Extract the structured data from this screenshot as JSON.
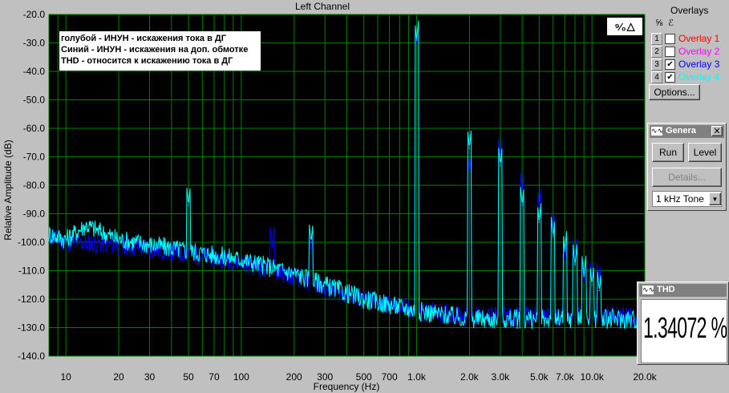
{
  "window": {
    "title": "Left Channel"
  },
  "toolbar": {
    "icons": [
      "scale-icon",
      "cursor-icon"
    ]
  },
  "legend": {
    "lines": [
      "голубой - ИНУН - искажения тока в ДГ",
      "Синий - ИНУН - искажения на доп. обмотке",
      "THD - относится к искажению тока в ДГ"
    ]
  },
  "overlays": {
    "title": "Overlays",
    "header_icons": "⅝ ℰ",
    "items": [
      {
        "num": "1",
        "label": "Overlay 1",
        "checked": false,
        "color": "#ff0000"
      },
      {
        "num": "2",
        "label": "Overlay 2",
        "checked": false,
        "color": "#ff00ff"
      },
      {
        "num": "3",
        "label": "Overlay 3",
        "checked": true,
        "color": "#0000ff"
      },
      {
        "num": "4",
        "label": "Overlay 4",
        "checked": true,
        "color": "#00ffff"
      }
    ],
    "options_label": "Options..."
  },
  "generator": {
    "title": "Genera",
    "run_label": "Run",
    "level_label": "Level",
    "details_label": "Details...",
    "tone_value": "1 kHz Tone"
  },
  "thd": {
    "title": "THD",
    "value": "1.34072 %"
  },
  "chart_data": {
    "type": "line",
    "title": "Left Channel",
    "xlabel": "Frequency (Hz)",
    "ylabel": "Relative Amplitude (dB)",
    "x_scale": "log",
    "xlim": [
      8,
      20000
    ],
    "ylim": [
      -140,
      -20
    ],
    "grid": true,
    "background": "#000000",
    "grid_color": "#008000",
    "y_ticks": [
      "-20.0",
      "-30.0",
      "-40.0",
      "-50.0",
      "-60.0",
      "-70.0",
      "-80.0",
      "-90.0",
      "-100.0",
      "-110.0",
      "-120.0",
      "-130.0",
      "-140.0"
    ],
    "y_tick_values": [
      -20,
      -30,
      -40,
      -50,
      -60,
      -70,
      -80,
      -90,
      -100,
      -110,
      -120,
      -130,
      -140
    ],
    "x_tick_labels": [
      "10",
      "20",
      "30",
      "50",
      "70",
      "100",
      "200",
      "300",
      "500",
      "700",
      "1.0k",
      "2.0k",
      "3.0k",
      "5.0k",
      "7.0k",
      "10.0k",
      "20.0k"
    ],
    "x_tick_values": [
      10,
      20,
      30,
      50,
      70,
      100,
      200,
      300,
      500,
      700,
      1000,
      2000,
      3000,
      5000,
      7000,
      10000,
      20000
    ],
    "series": [
      {
        "name": "Overlay 3",
        "color": "#0000ff",
        "floor": [
          [
            8,
            -98
          ],
          [
            10,
            -100
          ],
          [
            20,
            -101
          ],
          [
            50,
            -104
          ],
          [
            100,
            -107
          ],
          [
            200,
            -112
          ],
          [
            300,
            -116
          ],
          [
            500,
            -120
          ],
          [
            1000,
            -124
          ],
          [
            2000,
            -126
          ],
          [
            5000,
            -126
          ],
          [
            10000,
            -126
          ],
          [
            20000,
            -126
          ]
        ],
        "peaks": [
          [
            50,
            -106
          ],
          [
            150,
            -102
          ],
          [
            250,
            -104
          ],
          [
            1000,
            -30
          ],
          [
            2000,
            -76
          ],
          [
            3000,
            -70
          ],
          [
            4000,
            -82
          ],
          [
            5000,
            -88
          ],
          [
            6000,
            -96
          ],
          [
            7000,
            -106
          ],
          [
            8000,
            -106
          ],
          [
            9000,
            -114
          ],
          [
            10000,
            -113
          ],
          [
            11000,
            -114
          ]
        ]
      },
      {
        "name": "Overlay 4",
        "color": "#00ffff",
        "floor": [
          [
            8,
            -97
          ],
          [
            10,
            -99
          ],
          [
            13,
            -94
          ],
          [
            20,
            -99
          ],
          [
            50,
            -103
          ],
          [
            100,
            -106
          ],
          [
            200,
            -111
          ],
          [
            300,
            -115
          ],
          [
            500,
            -120
          ],
          [
            1000,
            -124
          ],
          [
            2000,
            -127
          ],
          [
            5000,
            -127
          ],
          [
            10000,
            -127
          ],
          [
            20000,
            -127
          ]
        ],
        "peaks": [
          [
            50,
            -87
          ],
          [
            250,
            -100
          ],
          [
            1000,
            -29
          ],
          [
            2000,
            -67
          ],
          [
            3000,
            -73
          ],
          [
            4000,
            -87
          ],
          [
            5000,
            -93
          ],
          [
            6000,
            -98
          ],
          [
            7000,
            -103
          ],
          [
            8000,
            -108
          ],
          [
            9000,
            -112
          ],
          [
            10000,
            -115
          ],
          [
            11000,
            -117
          ]
        ]
      }
    ]
  }
}
